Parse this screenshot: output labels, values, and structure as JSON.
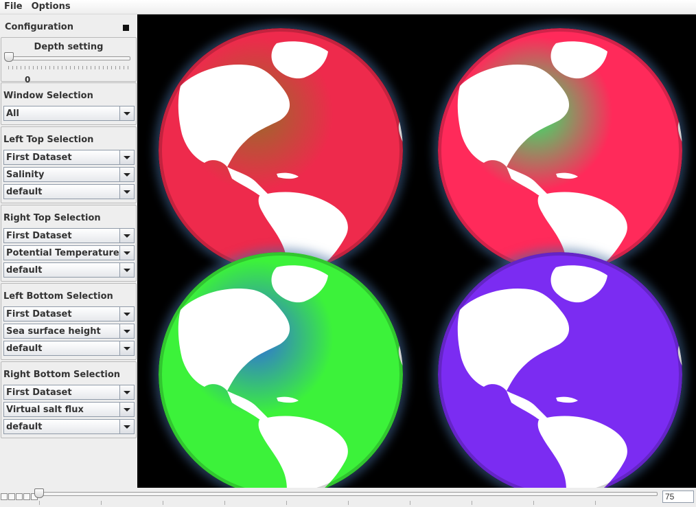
{
  "menu": {
    "file": "File",
    "options": "Options"
  },
  "config": {
    "title": "Configuration",
    "depth": {
      "label": "Depth setting",
      "value": "0"
    }
  },
  "groups": {
    "window": {
      "title": "Window Selection",
      "selected": "All"
    },
    "left_top": {
      "title": "Left Top Selection",
      "dataset": "First Dataset",
      "variable": "Salinity",
      "colormap": "default"
    },
    "right_top": {
      "title": "Right Top Selection",
      "dataset": "First Dataset",
      "variable": "Potential Temperature",
      "colormap": "default"
    },
    "left_bottom": {
      "title": "Left Bottom Selection",
      "dataset": "First Dataset",
      "variable": "Sea surface height",
      "colormap": "default"
    },
    "right_bottom": {
      "title": "Right Bottom Selection",
      "dataset": "First Dataset",
      "variable": "Virtual salt flux",
      "colormap": "default"
    }
  },
  "globes": {
    "left_top": {
      "ocean": "#ee2a4c",
      "accent": "#9a6a2a",
      "land": "#ffffff"
    },
    "right_top": {
      "ocean": "#ff2a5a",
      "accent": "#33e86a",
      "land": "#ffffff"
    },
    "left_bottom": {
      "ocean": "#3cf23a",
      "accent": "#2f6ae0",
      "land": "#ffffff"
    },
    "right_bottom": {
      "ocean": "#7b2cf2",
      "accent": "#7b2cf2",
      "land": "#ffffff"
    }
  },
  "timeline": {
    "value": "75",
    "position_fraction": 0.0
  }
}
